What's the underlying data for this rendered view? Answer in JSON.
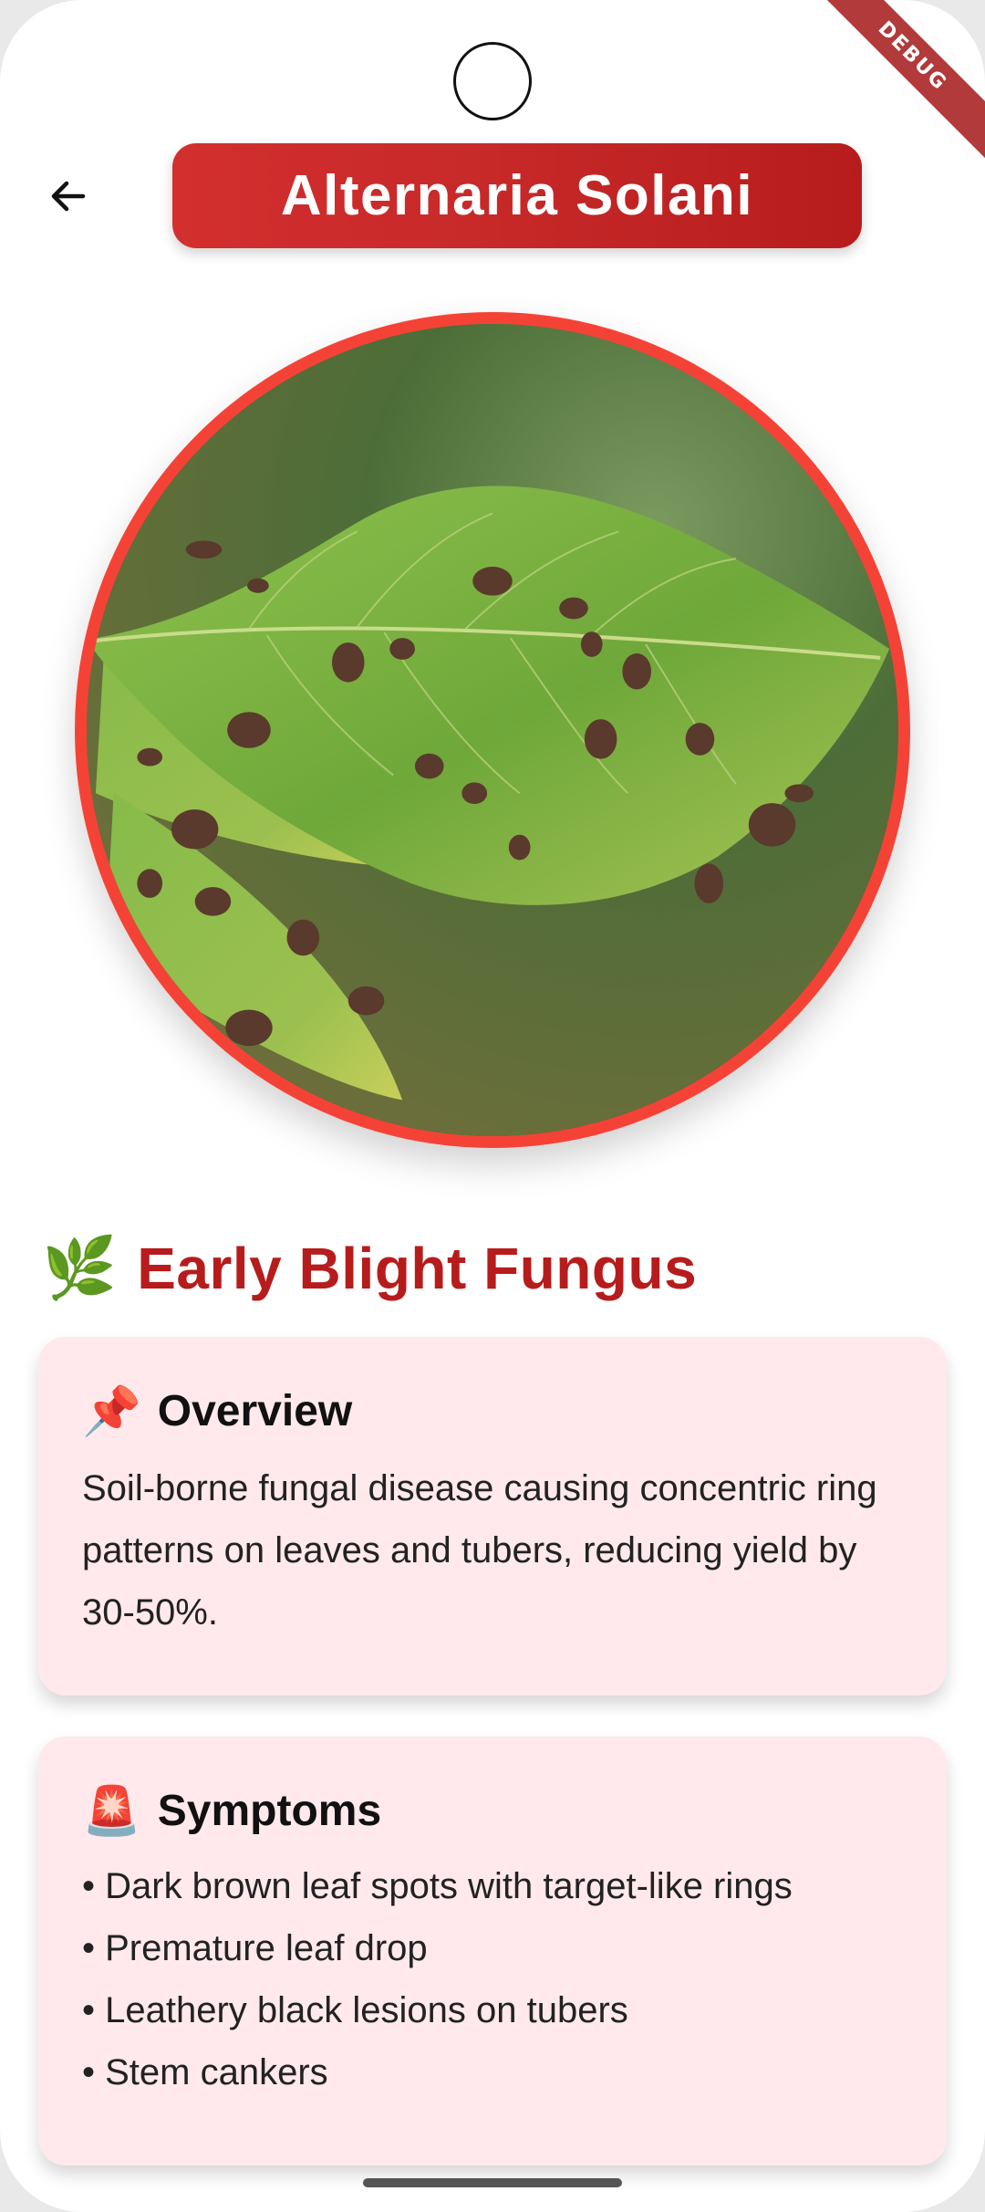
{
  "system": {
    "debug_label": "DEBUG"
  },
  "header": {
    "title": "Alternaria Solani"
  },
  "section": {
    "emoji": "🌿",
    "title": "Early Blight Fungus"
  },
  "overview": {
    "emoji": "📌",
    "title": "Overview",
    "body": "Soil-borne fungal disease causing concentric ring patterns on leaves and tubers, reducing yield by 30-50%."
  },
  "symptoms": {
    "emoji": "🚨",
    "title": "Symptoms",
    "items": [
      "• Dark brown leaf spots with target-like rings",
      "• Premature leaf drop",
      "• Leathery black lesions on tubers",
      "• Stem cankers"
    ]
  },
  "colors": {
    "title_pill": "#c62828",
    "circle_border": "#f44336",
    "heading": "#b71c1c",
    "card_bg": "#ffe9ec"
  }
}
